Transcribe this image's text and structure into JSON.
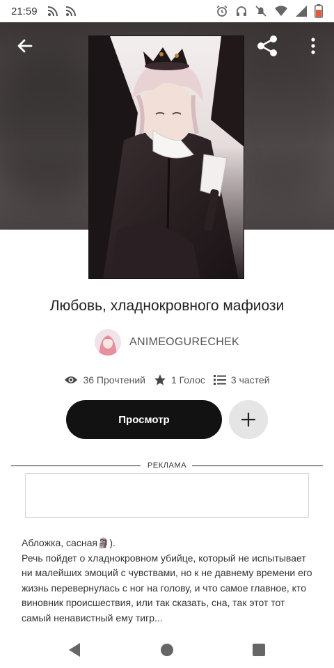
{
  "status_bar": {
    "time": "21:59",
    "left_icons": [
      "rss-icon",
      "rss-icon"
    ],
    "right_icons": [
      "alarm-icon",
      "headphones-icon",
      "mute-icon",
      "wifi-icon",
      "signal-icon",
      "battery-icon"
    ]
  },
  "header": {
    "back_icon": "arrow-left-icon",
    "share_icon": "share-icon",
    "more_icon": "more-vertical-icon"
  },
  "story": {
    "title": "Любовь, хладнокровного мафиози",
    "author": "ANIMEOGURECHEK",
    "stats": {
      "reads": "36 Прочтений",
      "votes": "1 Голос",
      "parts": "3 частей"
    },
    "view_button": "Просмотр",
    "add_icon": "plus-icon"
  },
  "ad": {
    "label": "РЕКЛАМА"
  },
  "description": {
    "line1": "Аблoжка, сасная🗿).",
    "line2": "Речь пойдет о хладнокровном убийце, который не испытывает ни малейших эмоций с чувствами, но к не давнему времени его жизнь перевернулась с ног на голову, и что самое главное, кто виновник происшествия, или так сказать, сна, так этот тот самый ненавистный ему тигр..."
  },
  "nav": {
    "back": "triangle-back-icon",
    "home": "circle-home-icon",
    "recents": "square-recents-icon"
  }
}
